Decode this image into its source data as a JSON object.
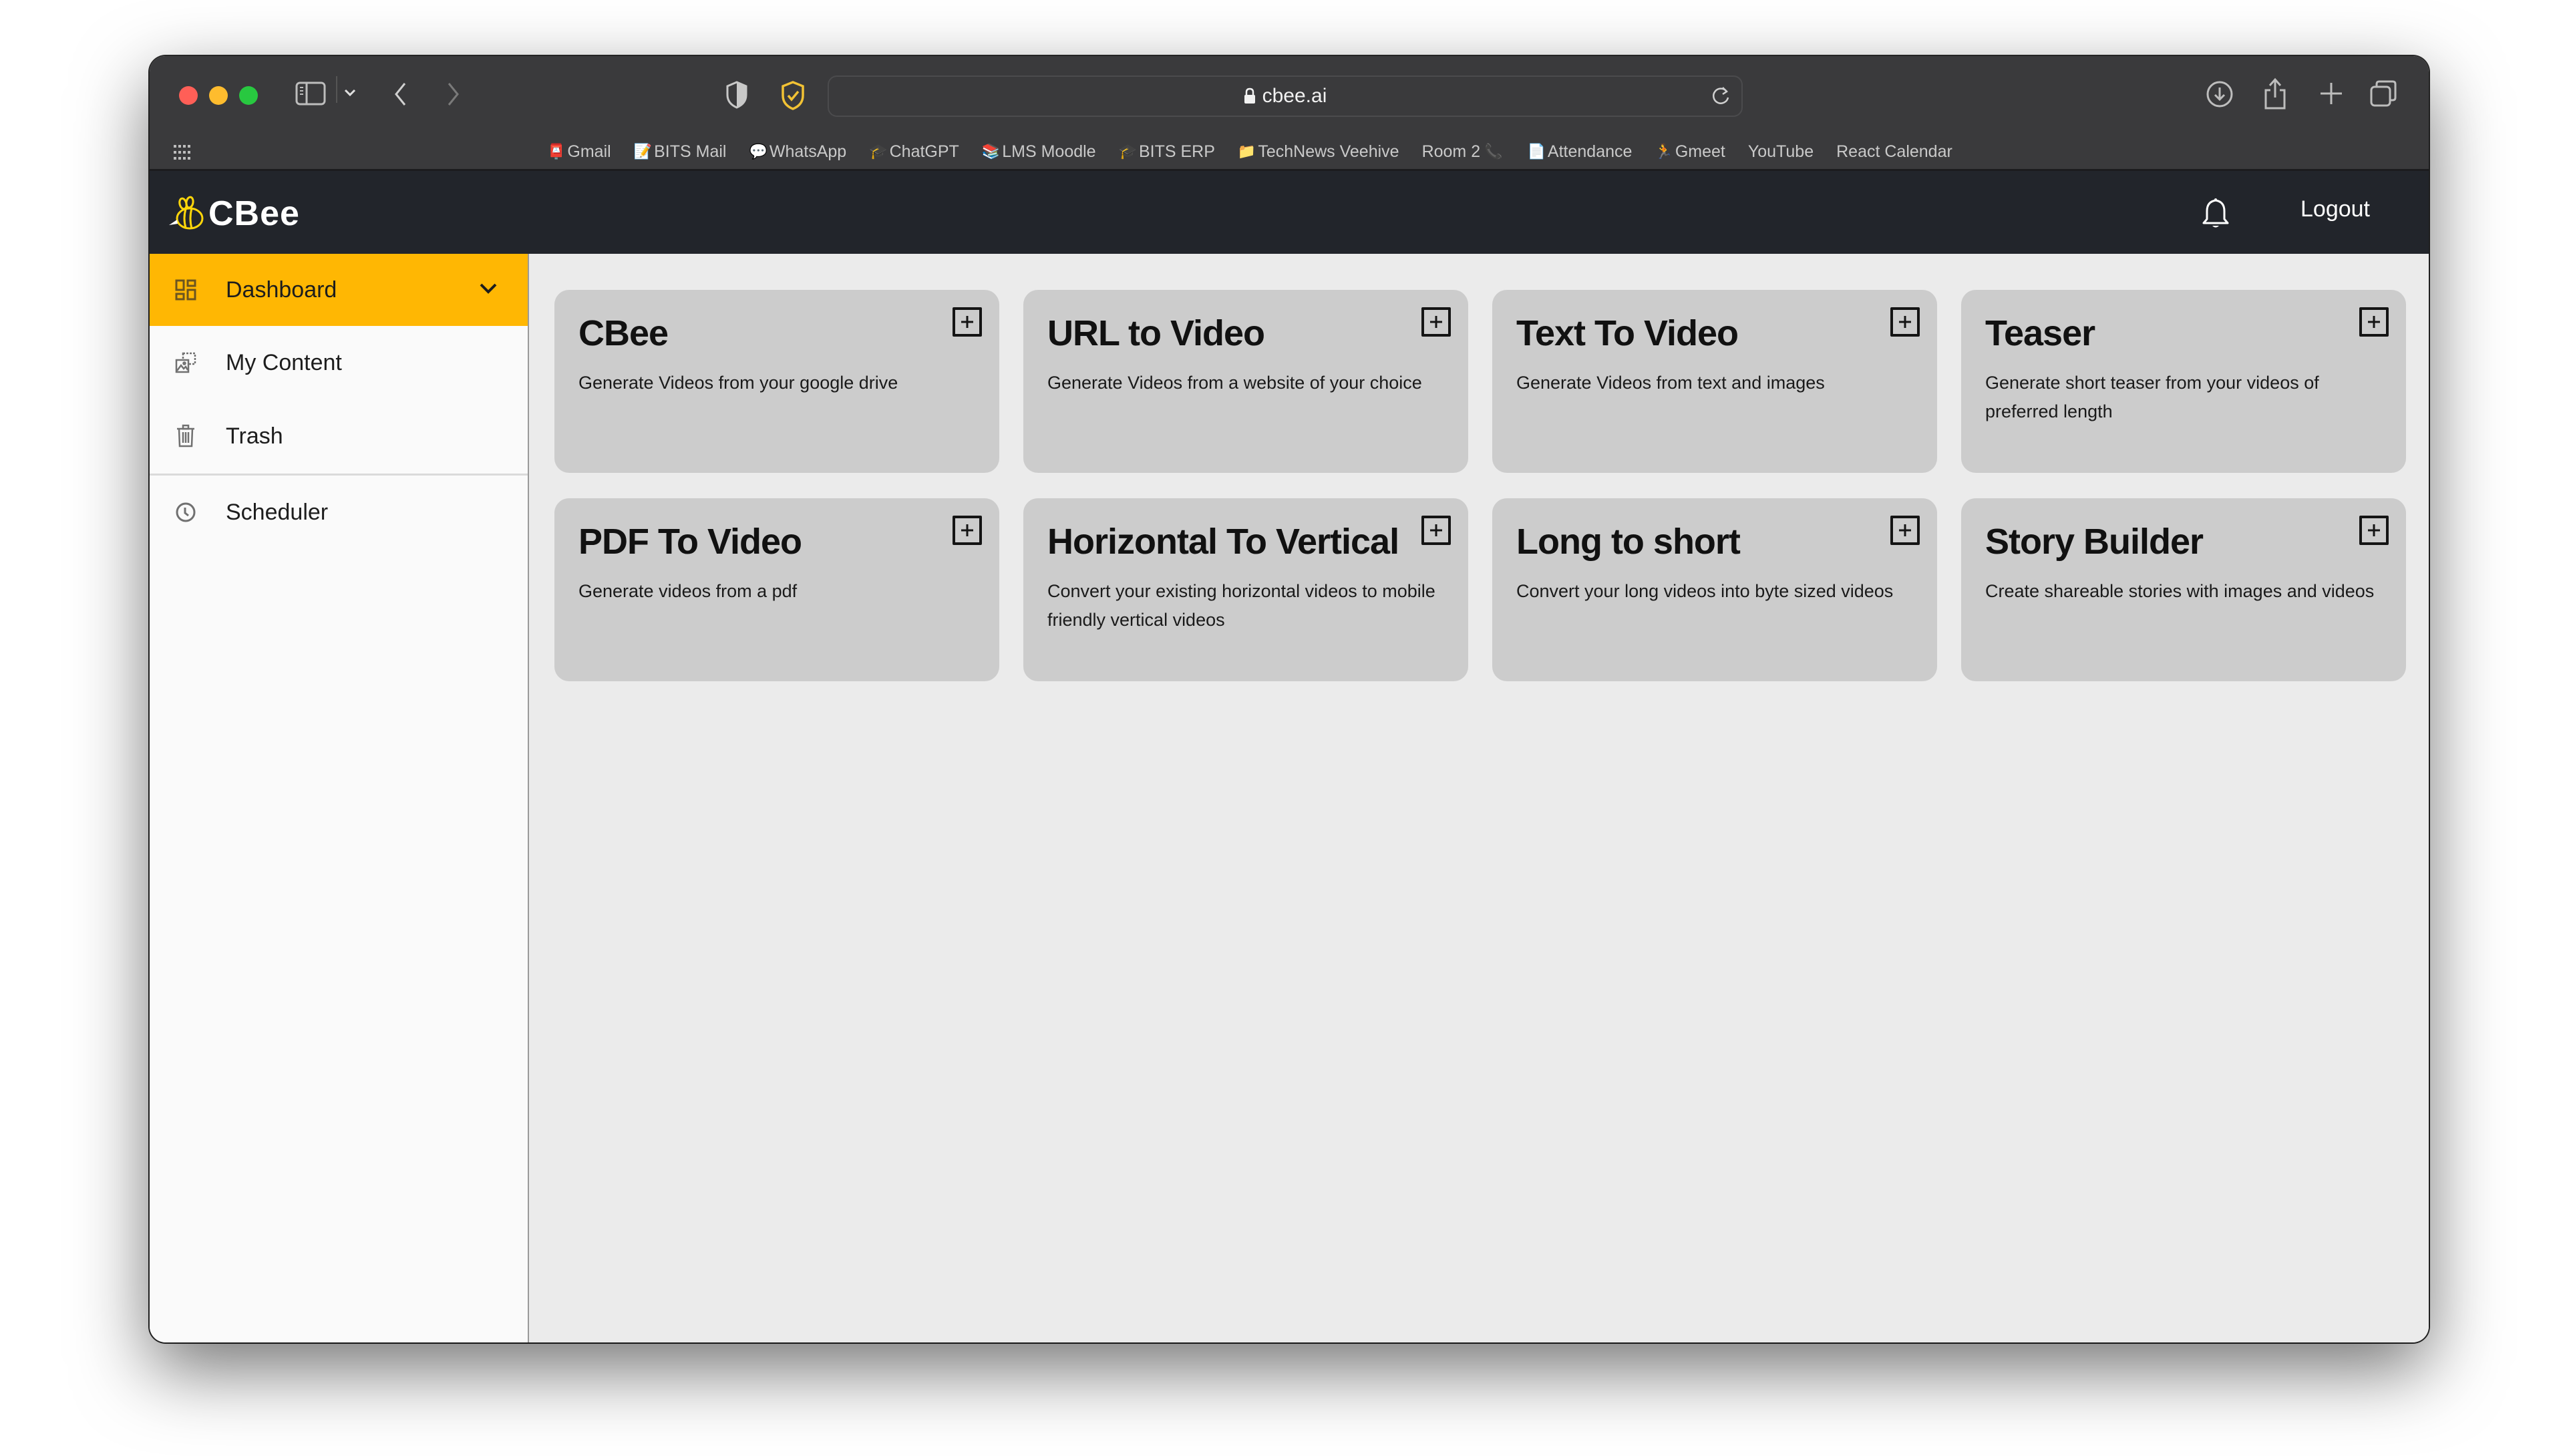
{
  "browser": {
    "url": "cbee.ai",
    "toolbar_icons": [
      "sidebar-toggle",
      "chevron-down",
      "back",
      "forward",
      "privacy-shield",
      "adblock-shield",
      "download",
      "share",
      "new-tab",
      "tab-overview"
    ],
    "bookmarks": [
      {
        "label": "Gmail",
        "icon": "📮"
      },
      {
        "label": "BITS Mail",
        "icon": "📝"
      },
      {
        "label": "WhatsApp",
        "icon": "💬"
      },
      {
        "label": "ChatGPT",
        "icon": "🎓"
      },
      {
        "label": "LMS Moodle",
        "icon": "📚"
      },
      {
        "label": "BITS ERP",
        "icon": "🎓"
      },
      {
        "label": "TechNews Veehive",
        "icon": "📁"
      },
      {
        "label": "Room 2",
        "icon": "📞",
        "icon_after": true
      },
      {
        "label": "Attendance",
        "icon": "📄"
      },
      {
        "label": "Gmeet",
        "icon": "🏃"
      },
      {
        "label": "YouTube",
        "icon": ""
      },
      {
        "label": "React Calendar",
        "icon": ""
      }
    ]
  },
  "header": {
    "brand": "CBee",
    "logout_label": "Logout",
    "brand_color": "#ffd60a",
    "background": "#22252b"
  },
  "sidebar": {
    "accent": "#ffb703",
    "items": [
      {
        "label": "Dashboard",
        "icon": "dashboard-grid",
        "active": true,
        "expandable": true
      },
      {
        "label": "My Content",
        "icon": "media-gallery"
      },
      {
        "label": "Trash",
        "icon": "trash"
      },
      {
        "label": "Scheduler",
        "icon": "clock"
      }
    ]
  },
  "cards": [
    {
      "title": "CBee",
      "description": "Generate Videos from your google drive"
    },
    {
      "title": "URL to Video",
      "description": "Generate Videos from a website of your choice"
    },
    {
      "title": "Text To Video",
      "description": "Generate Videos from text and images"
    },
    {
      "title": "Teaser",
      "description": "Generate short teaser from your videos of preferred length"
    },
    {
      "title": "PDF To Video",
      "description": "Generate videos from a pdf"
    },
    {
      "title": "Horizontal To Vertical",
      "description": "Convert your existing horizontal videos to mobile friendly vertical videos"
    },
    {
      "title": "Long to short",
      "description": "Convert your long videos into byte sized videos"
    },
    {
      "title": "Story Builder",
      "description": "Create shareable stories with images and videos"
    }
  ]
}
